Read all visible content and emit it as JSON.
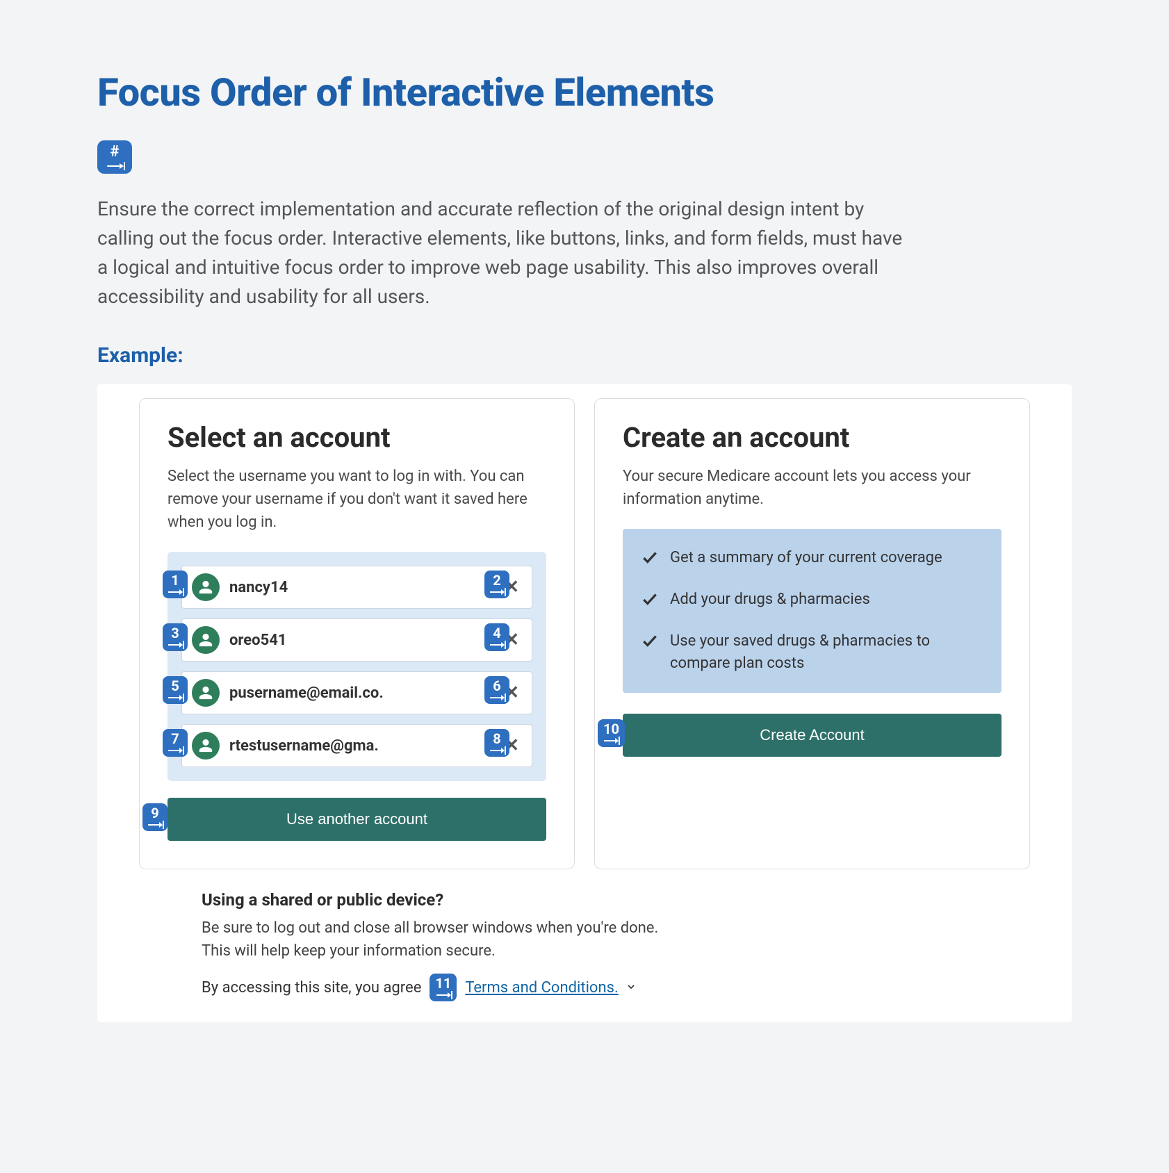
{
  "page_title": "Focus Order of Interactive Elements",
  "intro_badge_label": "#",
  "intro_text": "Ensure the correct implementation and accurate reflection of the original design intent by calling out the focus order. Interactive elements, like buttons, links, and form fields, must have a logical and intuitive focus order to improve web page usability. This also improves overall accessibility and usability for all users.",
  "example_label": "Example:",
  "select_card": {
    "title": "Select an account",
    "subtitle": "Select the username you want to log in with. You can remove your username if you don't want it saved here when you log in.",
    "accounts": [
      {
        "name": "nancy14",
        "focus_select": "1",
        "focus_remove": "2"
      },
      {
        "name": "oreo541",
        "focus_select": "3",
        "focus_remove": "4"
      },
      {
        "name": "pusername@email.co.",
        "focus_select": "5",
        "focus_remove": "6"
      },
      {
        "name": "rtestusername@gma.",
        "focus_select": "7",
        "focus_remove": "8"
      }
    ],
    "use_another_label": "Use another account",
    "use_another_focus": "9"
  },
  "create_card": {
    "title": "Create an account",
    "subtitle": "Your secure Medicare account lets you access your information anytime.",
    "benefits": [
      "Get a summary of your current coverage",
      "Add your drugs & pharmacies",
      "Use your saved drugs & pharmacies to compare plan costs"
    ],
    "create_label": "Create Account",
    "create_focus": "10"
  },
  "footer": {
    "shared_heading": "Using a shared or public device?",
    "shared_text": "Be sure to log out and close all browser windows when you're done. This will help keep your information secure.",
    "agree_prefix": "By accessing this site, you agree",
    "terms_link": "Terms and Conditions.",
    "terms_focus": "11"
  }
}
